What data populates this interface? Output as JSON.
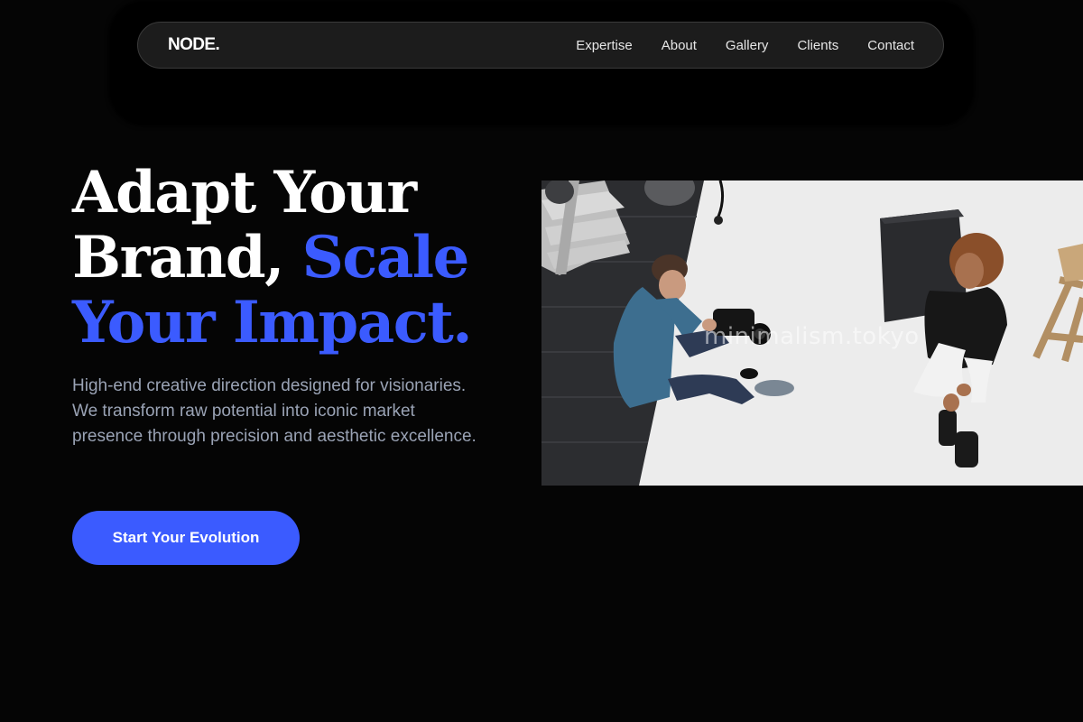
{
  "brand": {
    "logo": "NODE."
  },
  "nav": {
    "links": [
      "Expertise",
      "About",
      "Gallery",
      "Clients",
      "Contact"
    ]
  },
  "hero": {
    "title_line1": "Adapt Your",
    "title_line2_a": "Brand, ",
    "title_line2_b": "Scale",
    "title_line3": "Your Impact.",
    "description": "High-end creative direction designed for visionaries. We transform raw potential into iconic market presence through precision and aesthetic excellence.",
    "cta_label": "Start Your Evolution"
  },
  "media": {
    "watermark": "minimalism.tokyo",
    "scene": "photographer-and-model-studio"
  },
  "colors": {
    "background": "#050505",
    "accent": "#3b5bff",
    "nav_bg": "#1c1c1c",
    "muted_text": "#9aa3b5"
  }
}
